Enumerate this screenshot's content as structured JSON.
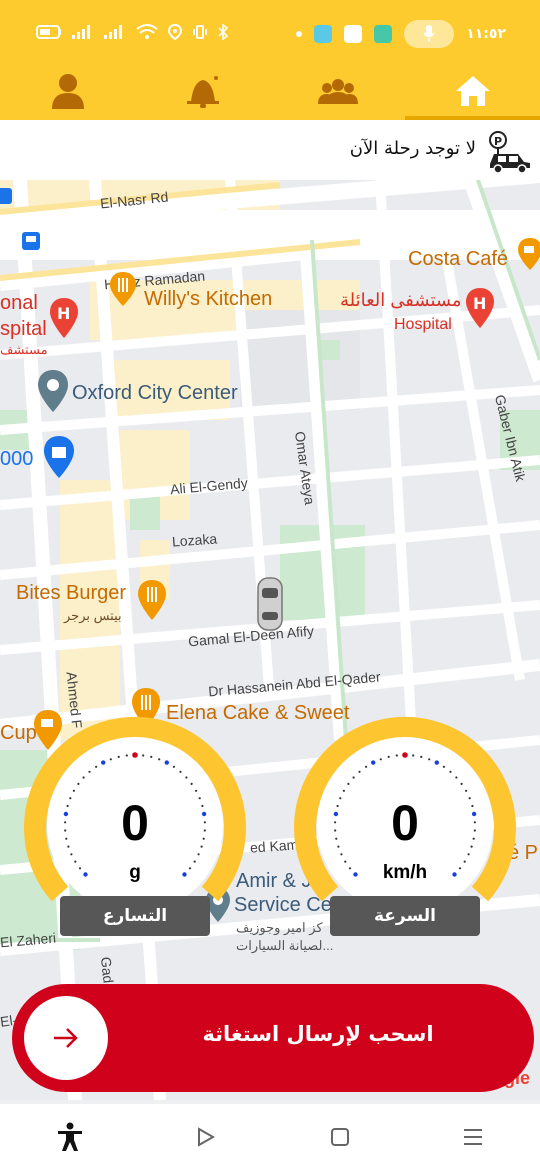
{
  "status_bar": {
    "time": "١١:٥٢"
  },
  "nav": {
    "items": [
      {
        "name": "profile",
        "icon": "person-icon"
      },
      {
        "name": "alerts",
        "icon": "bell-icon"
      },
      {
        "name": "groups",
        "icon": "group-icon"
      },
      {
        "name": "home",
        "icon": "home-icon",
        "active": true
      }
    ]
  },
  "trip": {
    "status_text": "لا توجد رحلة الآن",
    "icon": "car-parking-icon"
  },
  "map": {
    "road_labels": [
      "El-Nasr Rd",
      "Hafez Ramadan",
      "Ali El-Gendy",
      "Lozaka",
      "Gamal El-Deen Afify",
      "Dr Hassanein Abd El-Qader",
      "Omar Ateya",
      "Gaber Ibn Atik",
      "Ahmed F",
      "El Zaheri",
      "Gad",
      "El-D",
      "ed Kam"
    ],
    "pois": {
      "costa": "Costa Café",
      "willys": "Willy's Kitchen",
      "hospital_ar": "مستشفى العائلة",
      "hospital_en": "Hospital",
      "onal": "onal",
      "spital": "spital",
      "mostash": "مستشف",
      "oxford": "Oxford City Center",
      "num": "000",
      "bites": "Bites Burger",
      "bites_ar": "بيتس برجر",
      "elena": "Elena Cake & Sweet",
      "cup": "Cup",
      "amir": "Amir & J",
      "service": "Service Ce",
      "amir_ar1": "كز امير وجوزيف",
      "amir_ar2": "لصيانة السيارات...",
      "e_p": "é P",
      "google": "gle"
    }
  },
  "gauges": {
    "acceleration": {
      "value": "0",
      "unit": "g",
      "label": "التسارع"
    },
    "speed": {
      "value": "0",
      "unit": "km/h",
      "label": "السرعة"
    }
  },
  "sos": {
    "label": "اسحب لإرسال استغاثة"
  },
  "colors": {
    "header": "#fdcb2e",
    "gauge": "#fdc530",
    "sos": "#d0021b",
    "label_bg": "#575757"
  }
}
